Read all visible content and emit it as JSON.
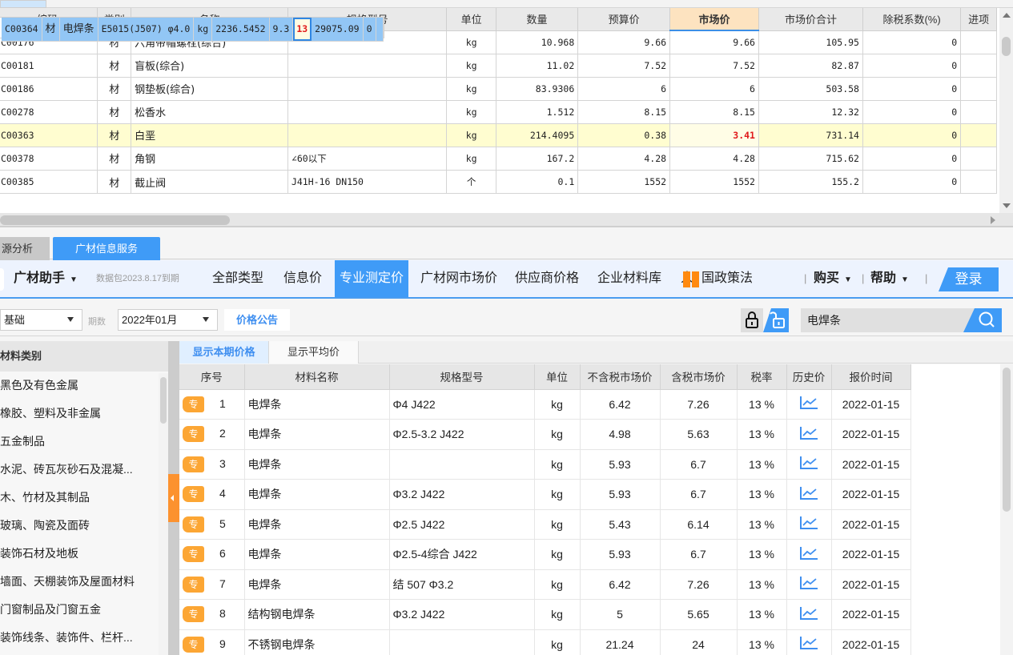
{
  "upper_grid": {
    "columns": [
      "编码",
      "类别",
      "名称",
      "规格型号",
      "单位",
      "数量",
      "预算价",
      "市场价",
      "市场价合计",
      "除税系数(%)",
      "进项"
    ],
    "rows": [
      {
        "code": "C00176",
        "type": "材",
        "name": "六角带帽螺栓(综合)",
        "spec": "",
        "unit": "kg",
        "qty": "10.968",
        "budget": "9.66",
        "market": "9.66",
        "total": "105.95",
        "tax_coef": "0"
      },
      {
        "code": "C00181",
        "type": "材",
        "name": "盲板(综合)",
        "spec": "",
        "unit": "kg",
        "qty": "11.02",
        "budget": "7.52",
        "market": "7.52",
        "total": "82.87",
        "tax_coef": "0"
      },
      {
        "code": "C00186",
        "type": "材",
        "name": "钢垫板(综合)",
        "spec": "",
        "unit": "kg",
        "qty": "83.9306",
        "budget": "6",
        "market": "6",
        "total": "503.58",
        "tax_coef": "0"
      },
      {
        "code": "C00278",
        "type": "材",
        "name": "松香水",
        "spec": "",
        "unit": "kg",
        "qty": "1.512",
        "budget": "8.15",
        "market": "8.15",
        "total": "12.32",
        "tax_coef": "0"
      },
      {
        "code": "C00363",
        "type": "材",
        "name": "白垩",
        "spec": "",
        "unit": "kg",
        "qty": "214.4095",
        "budget": "0.38",
        "market": "3.41",
        "total": "731.14",
        "tax_coef": "0"
      },
      {
        "code": "C00364",
        "type": "材",
        "name": "电焊条",
        "spec": "E5015(J507) φ4.0",
        "unit": "kg",
        "qty": "2236.5452",
        "budget": "9.3",
        "market": "13",
        "total": "29075.09",
        "tax_coef": "0"
      },
      {
        "code": "C00378",
        "type": "材",
        "name": "角钢",
        "spec": "∠60以下",
        "unit": "kg",
        "qty": "167.2",
        "budget": "4.28",
        "market": "4.28",
        "total": "715.62",
        "tax_coef": "0"
      },
      {
        "code": "C00385",
        "type": "材",
        "name": "截止阀",
        "spec": "J41H-16 DN150",
        "unit": "个",
        "qty": "0.1",
        "budget": "1552",
        "market": "1552",
        "total": "155.2",
        "tax_coef": "0"
      }
    ]
  },
  "bottom_tabs": [
    "源分析",
    "广材信息服务"
  ],
  "toolbar": {
    "brand": "广材助手",
    "package_note": "数据包2023.8.17到期",
    "items": [
      "全部类型",
      "信息价",
      "专业测定价",
      "广材网市场价",
      "供应商价格",
      "企业材料库",
      "人",
      "国政策法"
    ],
    "buy": "购买",
    "help": "帮助",
    "login": "登录"
  },
  "filters": {
    "category_select": "基础",
    "period_label": "期数",
    "period_select": "2022年01月",
    "notice_button": "价格公告",
    "search_value": "电焊条"
  },
  "categories": {
    "header": "材料类别",
    "items": [
      "黑色及有色金属",
      "橡胶、塑料及非金属",
      "五金制品",
      "水泥、砖瓦灰砂石及混凝...",
      "木、竹材及其制品",
      "玻璃、陶瓷及面砖",
      "装饰石材及地板",
      "墙面、天棚装饰及屋面材料",
      "门窗制品及门窗五金",
      "装饰线条、装饰件、栏杆..."
    ]
  },
  "result_tabs": [
    "显示本期价格",
    "显示平均价"
  ],
  "results": {
    "columns": [
      "序号",
      "材料名称",
      "规格型号",
      "单位",
      "不含税市场价",
      "含税市场价",
      "税率",
      "历史价",
      "报价时间"
    ],
    "badge": "专",
    "rows": [
      {
        "no": "1",
        "name": "电焊条",
        "spec": "Φ4 J422",
        "unit": "kg",
        "pre_tax": "6.42",
        "with_tax": "7.26",
        "rate": "13 %",
        "date": "2022-01-15"
      },
      {
        "no": "2",
        "name": "电焊条",
        "spec": "Φ2.5-3.2 J422",
        "unit": "kg",
        "pre_tax": "4.98",
        "with_tax": "5.63",
        "rate": "13 %",
        "date": "2022-01-15"
      },
      {
        "no": "3",
        "name": "电焊条",
        "spec": "",
        "unit": "kg",
        "pre_tax": "5.93",
        "with_tax": "6.7",
        "rate": "13 %",
        "date": "2022-01-15"
      },
      {
        "no": "4",
        "name": "电焊条",
        "spec": "Φ3.2 J422",
        "unit": "kg",
        "pre_tax": "5.93",
        "with_tax": "6.7",
        "rate": "13 %",
        "date": "2022-01-15"
      },
      {
        "no": "5",
        "name": "电焊条",
        "spec": "Φ2.5 J422",
        "unit": "kg",
        "pre_tax": "5.43",
        "with_tax": "6.14",
        "rate": "13 %",
        "date": "2022-01-15"
      },
      {
        "no": "6",
        "name": "电焊条",
        "spec": "Φ2.5-4综合 J422",
        "unit": "kg",
        "pre_tax": "5.93",
        "with_tax": "6.7",
        "rate": "13 %",
        "date": "2022-01-15"
      },
      {
        "no": "7",
        "name": "电焊条",
        "spec": "结 507 Φ3.2",
        "unit": "kg",
        "pre_tax": "6.42",
        "with_tax": "7.26",
        "rate": "13 %",
        "date": "2022-01-15"
      },
      {
        "no": "8",
        "name": "结构钢电焊条",
        "spec": "Φ3.2 J422",
        "unit": "kg",
        "pre_tax": "5",
        "with_tax": "5.65",
        "rate": "13 %",
        "date": "2022-01-15"
      },
      {
        "no": "9",
        "name": "不锈钢电焊条",
        "spec": "",
        "unit": "kg",
        "pre_tax": "21.24",
        "with_tax": "24",
        "rate": "13 %",
        "date": "2022-01-15"
      }
    ]
  },
  "colors": {
    "accent": "#3f9bf7",
    "badge": "#fca634",
    "highlight_red": "#e0191b",
    "selected_row": "#92c6f5",
    "yellow_row": "#fffdd0"
  }
}
